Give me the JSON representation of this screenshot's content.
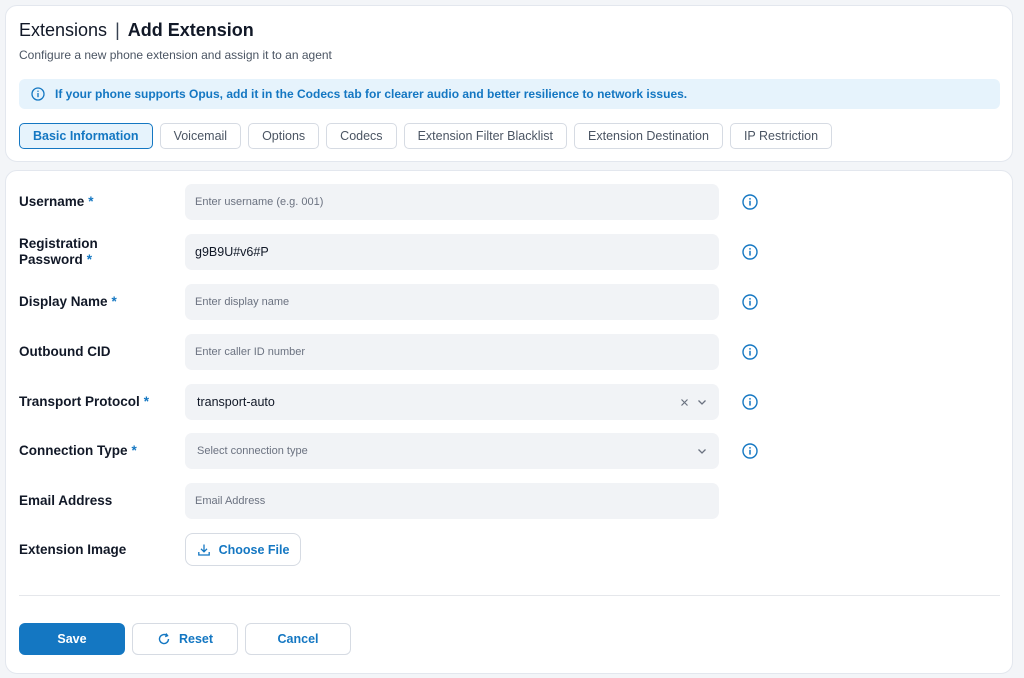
{
  "header": {
    "section": "Extensions",
    "separator": "|",
    "page_title": "Add Extension",
    "subtitle": "Configure a new phone extension and assign it to an agent"
  },
  "banner": {
    "icon": "info-circle-icon",
    "text": "If your phone supports Opus, add it in the Codecs tab for clearer audio and better resilience to network issues."
  },
  "tabs": [
    {
      "label": "Basic Information",
      "active": true
    },
    {
      "label": "Voicemail",
      "active": false
    },
    {
      "label": "Options",
      "active": false
    },
    {
      "label": "Codecs",
      "active": false
    },
    {
      "label": "Extension Filter Blacklist",
      "active": false
    },
    {
      "label": "Extension Destination",
      "active": false
    },
    {
      "label": "IP Restriction",
      "active": false
    }
  ],
  "form": {
    "required_marker": "*",
    "username": {
      "label": "Username",
      "placeholder": "Enter username (e.g. 001)",
      "value": ""
    },
    "registration_password": {
      "label_line1": "Registration",
      "label_line2": "Password",
      "value": "g9B9U#v6#P"
    },
    "display_name": {
      "label": "Display Name",
      "placeholder": "Enter display name",
      "value": ""
    },
    "outbound_cid": {
      "label": "Outbound CID",
      "placeholder": "Enter caller ID number",
      "value": ""
    },
    "transport_protocol": {
      "label": "Transport Protocol",
      "selected": "transport-auto"
    },
    "connection_type": {
      "label": "Connection Type",
      "placeholder": "Select connection type"
    },
    "email_address": {
      "label": "Email Address",
      "placeholder": "Email Address",
      "value": ""
    },
    "extension_image": {
      "label": "Extension Image",
      "button_label": "Choose File"
    }
  },
  "actions": {
    "save": "Save",
    "reset": "Reset",
    "cancel": "Cancel"
  },
  "colors": {
    "accent": "#1477c2",
    "banner_bg": "#e6f3fc",
    "field_bg": "#f1f3f6"
  }
}
